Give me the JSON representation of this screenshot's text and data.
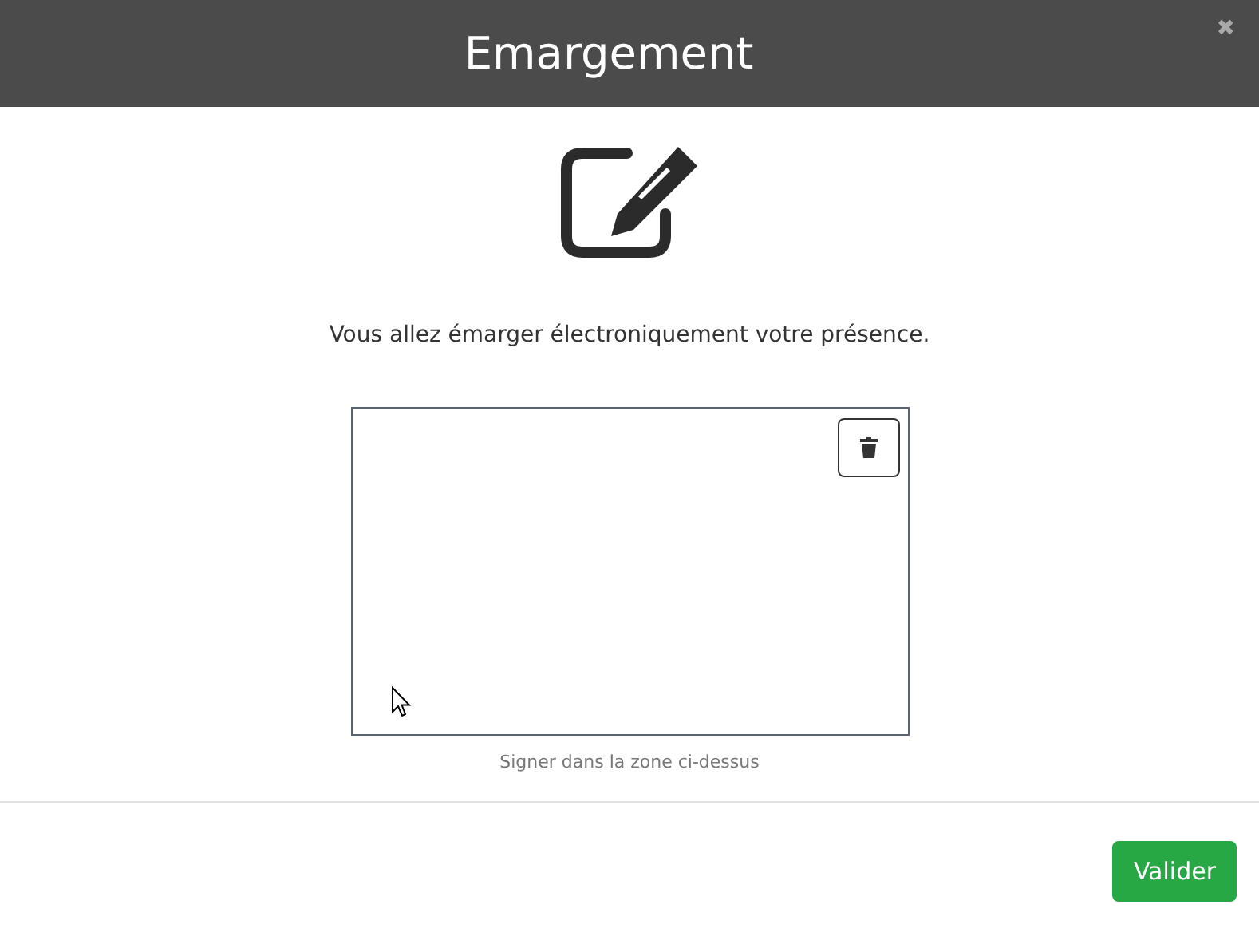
{
  "dialog": {
    "title": "Emargement",
    "close": "✖",
    "message": "Vous allez émarger électroniquement votre présence.",
    "signature_hint": "Signer dans la zone ci-dessus",
    "buttons": [
      {
        "label": "Valider",
        "kind": "primary"
      }
    ]
  }
}
